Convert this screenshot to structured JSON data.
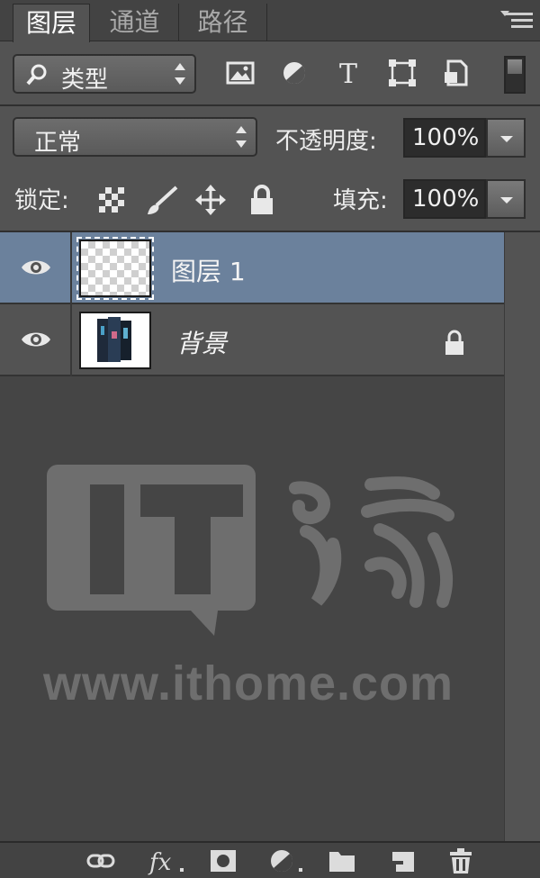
{
  "tabs": [
    {
      "label": "图层",
      "active": true
    },
    {
      "label": "通道",
      "active": false
    },
    {
      "label": "路径",
      "active": false
    }
  ],
  "filter": {
    "kind_label": "类型",
    "icons": [
      "image-filter-icon",
      "adjustment-filter-icon",
      "type-filter-icon",
      "shape-filter-icon",
      "smart-object-filter-icon"
    ],
    "type_glyph": "T"
  },
  "blend": {
    "mode": "正常",
    "opacity_label": "不透明度:",
    "opacity_value": "100%"
  },
  "lock": {
    "label": "锁定:",
    "fill_label": "填充:",
    "fill_value": "100%"
  },
  "layers": [
    {
      "name": "图层 1",
      "visible": true,
      "selected": true,
      "locked": false
    },
    {
      "name": "背景",
      "visible": true,
      "selected": false,
      "locked": true
    }
  ],
  "watermark": {
    "logo": "IT之家",
    "url": "www.ithome.com"
  },
  "footer_icons": [
    "link-layers-icon",
    "fx-icon",
    "add-mask-icon",
    "adjustment-layer-icon",
    "new-group-icon",
    "new-layer-icon",
    "delete-layer-icon"
  ],
  "footer": {
    "fx_label": "fx"
  },
  "colors": {
    "panel": "#535353",
    "selected_row": "#6b819c",
    "watermark": "#6e6e6e"
  }
}
